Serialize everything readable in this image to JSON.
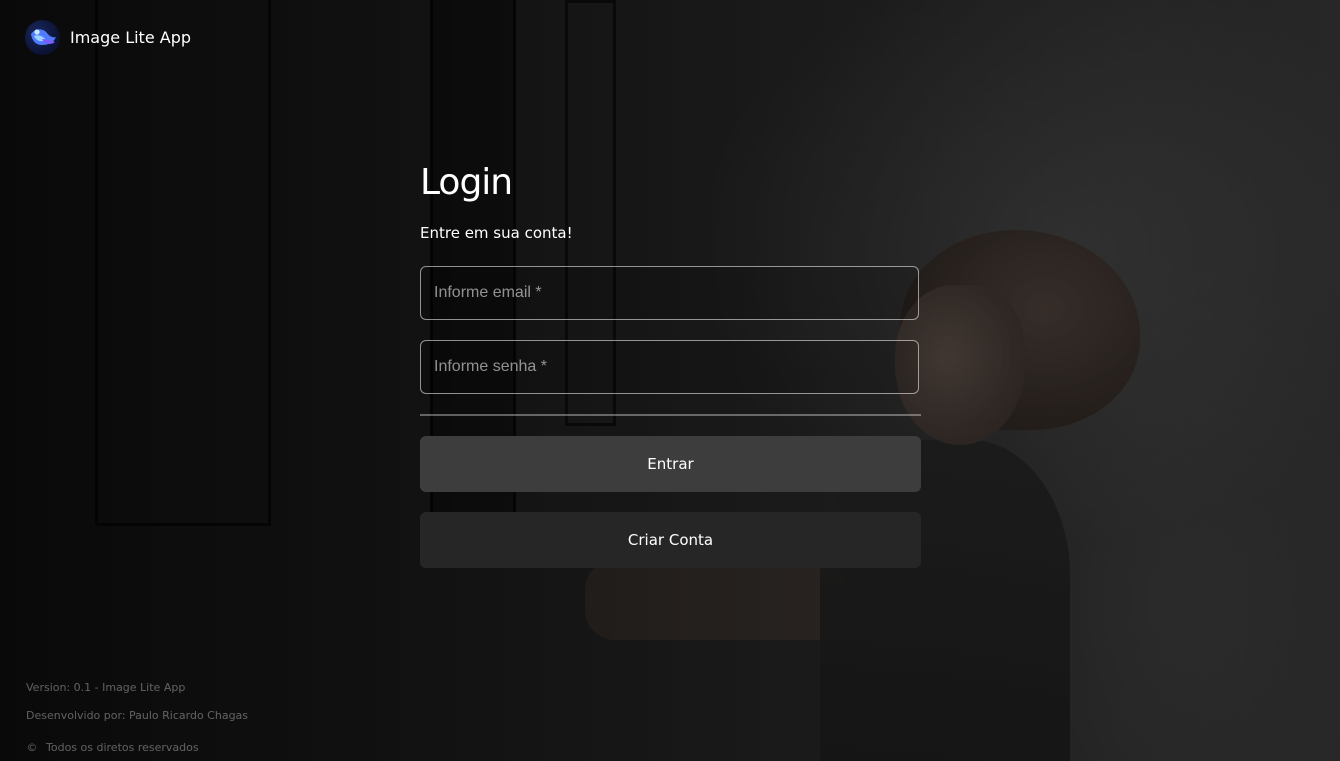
{
  "app": {
    "name": "Image Lite App",
    "logo_icon": "bird-logo-icon"
  },
  "login": {
    "title": "Login",
    "subtitle": "Entre em sua conta!",
    "email_placeholder": "Informe email *",
    "email_value": "",
    "password_placeholder": "Informe senha *",
    "password_value": "",
    "submit_label": "Entrar",
    "create_account_label": "Criar Conta"
  },
  "footer": {
    "version": "Version: 0.1 - Image Lite App",
    "developer": "Desenvolvido por: Paulo Ricardo Chagas",
    "copyright_icon": "©",
    "rights": "Todos os diretos reservados"
  },
  "colors": {
    "primary_button": "#3d3d3d",
    "secondary_button": "#262626",
    "text": "#ffffff"
  }
}
